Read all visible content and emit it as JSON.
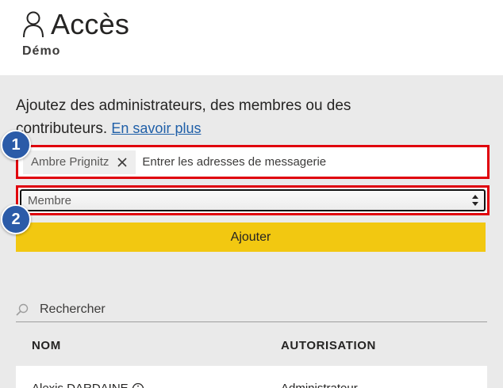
{
  "header": {
    "title": "Accès",
    "subtitle": "Démo"
  },
  "intro": {
    "text": "Ajoutez des administrateurs, des membres ou des contributeurs.",
    "link": "En savoir plus"
  },
  "email_field": {
    "chip_label": "Ambre Prignitz",
    "placeholder": "Entrer les adresses de messagerie"
  },
  "role_select": {
    "value": "Membre"
  },
  "add_button": {
    "label": "Ajouter",
    "color": "#f2c811"
  },
  "badges": [
    "1",
    "2"
  ],
  "search": {
    "placeholder": "Rechercher"
  },
  "table": {
    "columns": [
      "NOM",
      "AUTORISATION"
    ],
    "rows": [
      {
        "name": "Alexis DARDAINE",
        "permission": "Administrateur"
      }
    ]
  },
  "colors": {
    "highlight": "#e0000c",
    "badge": "#2b5ba8",
    "link": "#1f5fa8"
  }
}
